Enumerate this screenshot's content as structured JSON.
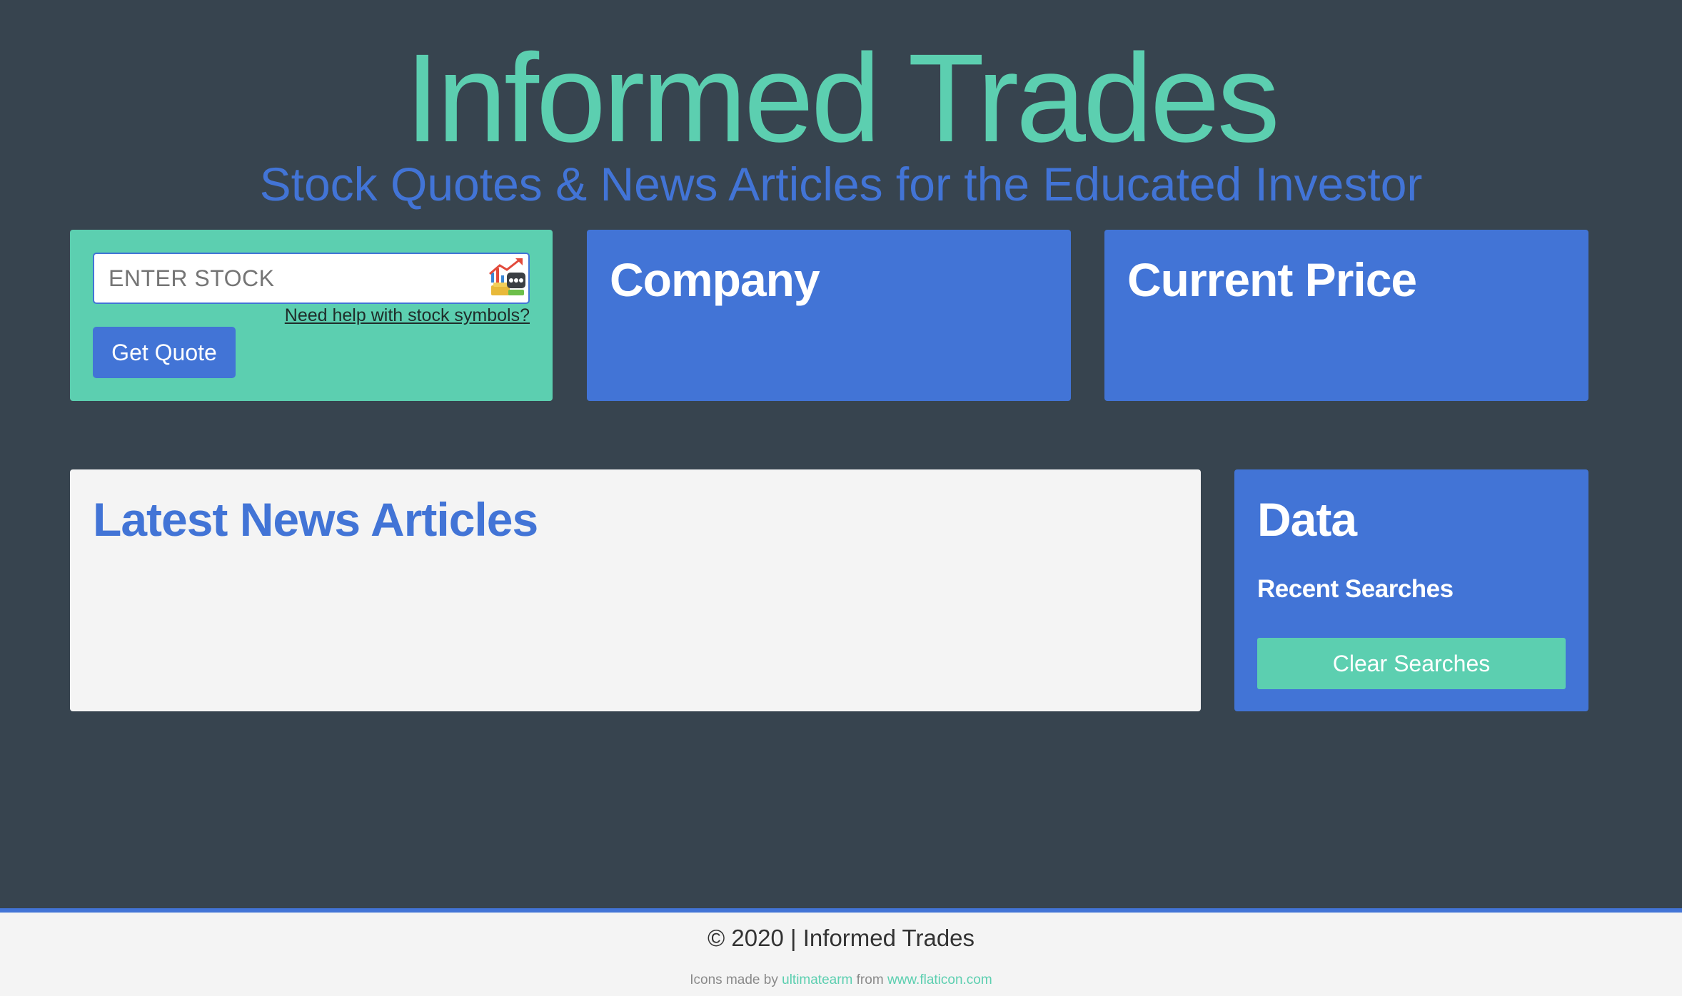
{
  "header": {
    "title": "Informed Trades",
    "subtitle": "Stock Quotes & News Articles for the Educated Investor"
  },
  "search": {
    "placeholder": "ENTER STOCK",
    "value": "",
    "icon": "stock-chart-icon",
    "help_link": "Need help with stock symbols?",
    "button_label": "Get Quote"
  },
  "company_card": {
    "heading": "Company"
  },
  "price_card": {
    "heading": "Current Price"
  },
  "news": {
    "heading": "Latest News Articles"
  },
  "data_panel": {
    "heading": "Data",
    "recent_label": "Recent Searches",
    "clear_button_label": "Clear Searches"
  },
  "footer": {
    "copyright": "© 2020 | Informed Trades",
    "credit_prefix": "Icons made by",
    "credit_author": "ultimatearm",
    "credit_middle": "from",
    "credit_site": "www.flaticon.com"
  },
  "colors": {
    "background": "#37444f",
    "teal": "#5ccfb0",
    "blue": "#4274d6",
    "light": "#f4f4f4"
  }
}
